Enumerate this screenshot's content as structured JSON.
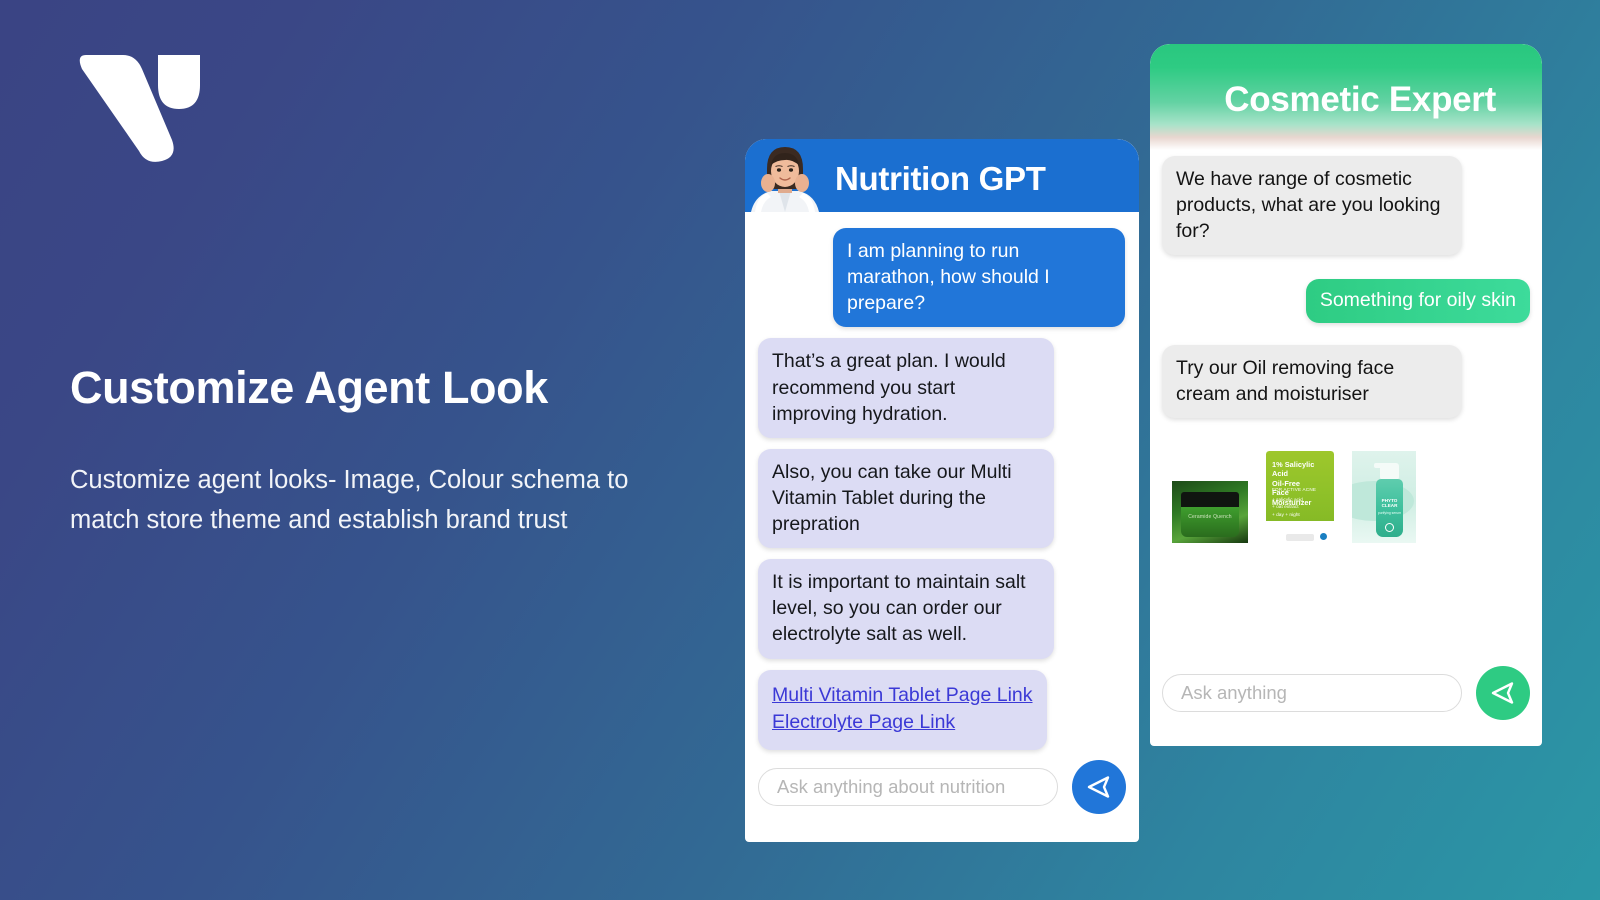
{
  "background": {
    "gradient_from": "#3a4484",
    "gradient_to": "#2b97a6"
  },
  "left": {
    "logo_name": "v-logo",
    "headline": "Customize Agent Look",
    "subtext": "Customize agent looks- Image, Colour schema to match store theme and establish brand trust"
  },
  "nutrition": {
    "title": "Nutrition GPT",
    "accent": "#1b6fd0",
    "avatar_name": "nutritionist-avatar-photo",
    "messages": [
      {
        "sender": "user",
        "text": "I am planning to run marathon, how should I prepare?"
      },
      {
        "sender": "bot",
        "text": "That’s a great plan. I would recommend you start improving  hydration."
      },
      {
        "sender": "bot",
        "text": "Also, you can take our Multi Vitamin Tablet during the prepration"
      },
      {
        "sender": "bot",
        "text": "It is important to maintain salt level, so you can order our electrolyte salt as well."
      }
    ],
    "links": [
      "Multi Vitamin Tablet Page Link",
      "Electrolyte Page Link"
    ],
    "composer": {
      "placeholder": "Ask anything about nutrition",
      "send_icon": "send-triangle-icon",
      "send_color": "#2176d9"
    }
  },
  "cosmetic": {
    "title": "Cosmetic Expert",
    "accent": "#2ecb83",
    "messages": [
      {
        "sender": "bot",
        "text": "We have range of cosmetic products, what are you looking for?"
      },
      {
        "sender": "user",
        "text": "Something for oily skin"
      },
      {
        "sender": "bot",
        "text": "Try our Oil removing face cream and moisturiser"
      }
    ],
    "products": [
      {
        "name": "green-cream-jar",
        "label": "Ceramide Quench"
      },
      {
        "name": "salicylic-acid-tube",
        "line1": "1% Salicylic Acid",
        "line2": "Oil-Free",
        "line3": "Face Moisturizer",
        "sub": "FOR ACTIVE ACNE",
        "bullets": "+ salicylic acid\n+ oat extract\n+ day + night"
      },
      {
        "name": "phyto-clear-bottle",
        "brand": "PHYTO CLEAR",
        "sub": "purifying serum"
      }
    ],
    "composer": {
      "placeholder": "Ask anything",
      "send_icon": "send-triangle-icon",
      "send_color": "#2ecb83"
    }
  }
}
